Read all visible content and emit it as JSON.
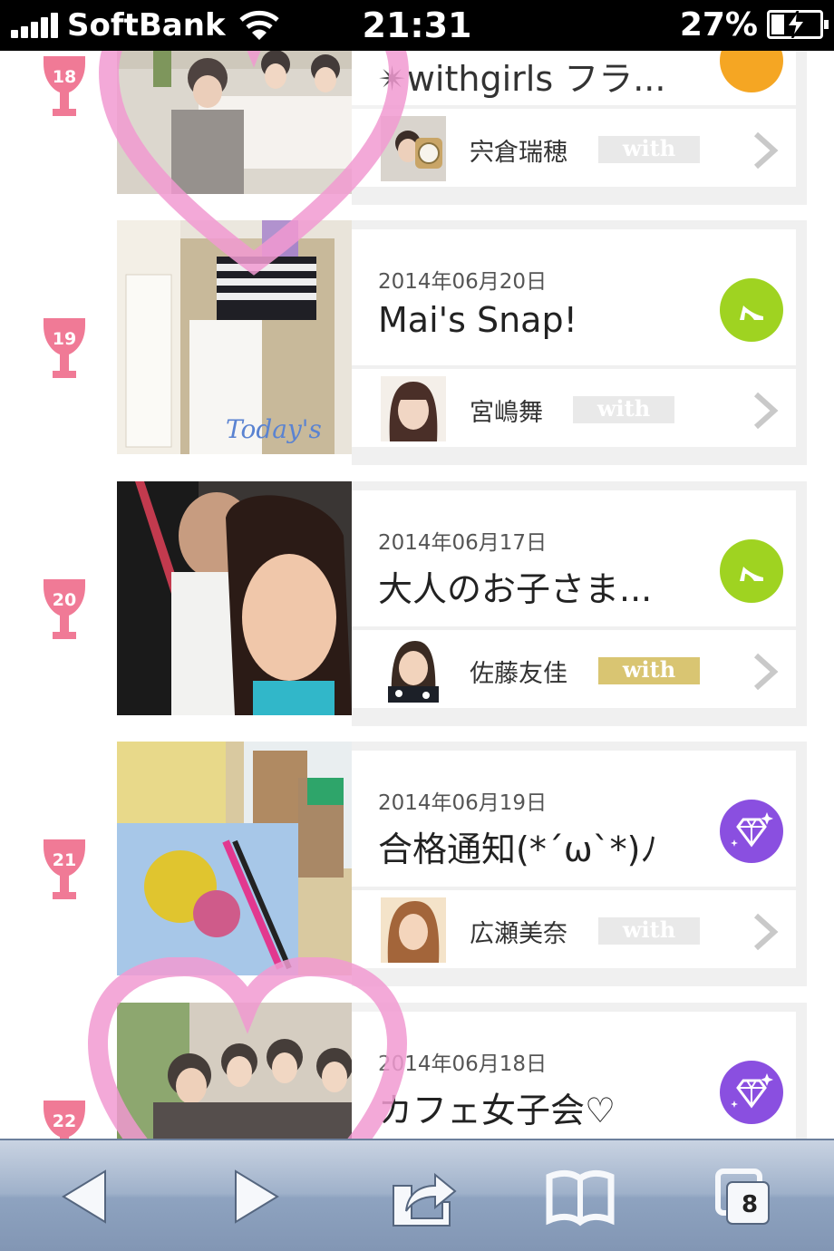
{
  "status_bar": {
    "carrier": "SoftBank",
    "time": "21:31",
    "battery_percent": "27%",
    "battery_level": 0.27,
    "signal_bars": 5
  },
  "list": {
    "items": [
      {
        "rank": "18",
        "date": "",
        "title": "✴withgirls フラ...",
        "author": "宍倉瑞穂",
        "badge": "with",
        "badge_highlighted": false,
        "category_icon": "",
        "category_color": "#f5a623"
      },
      {
        "rank": "19",
        "date": "2014年06月20日",
        "title": "Mai's Snap!",
        "author": "宮嶋舞",
        "badge": "with",
        "badge_highlighted": false,
        "category_icon": "high-heel-icon",
        "category_color": "#9fd321"
      },
      {
        "rank": "20",
        "date": "2014年06月17日",
        "title": "大人のお子さま...",
        "author": "佐藤友佳",
        "badge": "with",
        "badge_highlighted": true,
        "category_icon": "high-heel-icon",
        "category_color": "#9fd321"
      },
      {
        "rank": "21",
        "date": "2014年06月19日",
        "title": "合格通知(*´ω`*)ﾉ",
        "author": "広瀬美奈",
        "badge": "with",
        "badge_highlighted": false,
        "category_icon": "diamond-icon",
        "category_color": "#8a4fe0"
      },
      {
        "rank": "22",
        "date": "2014年06月18日",
        "title": "カフェ女子会♡",
        "author": "",
        "badge": "",
        "badge_highlighted": false,
        "category_icon": "diamond-icon",
        "category_color": "#8a4fe0"
      }
    ]
  },
  "toolbar": {
    "buttons": [
      "back-arrow-icon",
      "forward-arrow-icon",
      "share-icon",
      "bookmarks-icon",
      "tabs-icon"
    ],
    "tab_count": "8"
  },
  "colors": {
    "rank_cup": "#f07a96",
    "heart_overlay": "#f29bd2",
    "gold_badge": "#d9c572"
  }
}
